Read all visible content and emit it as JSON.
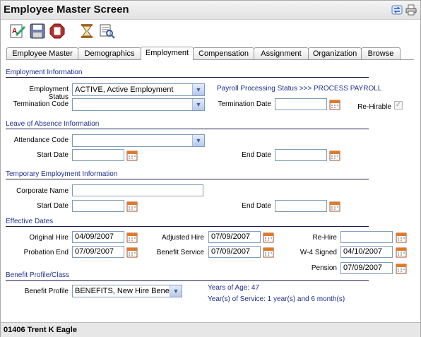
{
  "window": {
    "title": "Employee Master Screen"
  },
  "toolbar": {
    "icons": [
      "spell-check-icon",
      "save-icon",
      "stop-icon",
      "hourglass-icon",
      "lookup-icon"
    ]
  },
  "tabs": [
    {
      "label": "Employee Master"
    },
    {
      "label": "Demographics"
    },
    {
      "label": "Employment"
    },
    {
      "label": "Compensation"
    },
    {
      "label": "Assignment"
    },
    {
      "label": "Organization"
    },
    {
      "label": "Browse"
    }
  ],
  "active_tab": "Employment",
  "employment_info": {
    "heading": "Employment Information",
    "status_label": "Employment Status",
    "status_value": "ACTIVE, Active Employment",
    "payroll_status": "Payroll Processing Status >>> PROCESS PAYROLL",
    "termination_code_label": "Termination Code",
    "termination_code_value": "",
    "termination_date_label": "Termination Date",
    "termination_date_value": "",
    "rehirable_label": "Re-Hirable",
    "rehirable_checked": true
  },
  "leave_of_absence": {
    "heading": "Leave of Absence Information",
    "attendance_code_label": "Attendance Code",
    "attendance_code_value": "",
    "start_date_label": "Start Date",
    "start_date_value": "",
    "end_date_label": "End Date",
    "end_date_value": ""
  },
  "temporary_employment": {
    "heading": "Temporary Employment Information",
    "corporate_name_label": "Corporate Name",
    "corporate_name_value": "",
    "start_date_label": "Start Date",
    "start_date_value": "",
    "end_date_label": "End Date",
    "end_date_value": ""
  },
  "effective_dates": {
    "heading": "Effective Dates",
    "original_hire_label": "Original Hire",
    "original_hire_value": "04/09/2007",
    "adjusted_hire_label": "Adjusted Hire",
    "adjusted_hire_value": "07/09/2007",
    "rehire_label": "Re-Hire",
    "rehire_value": "",
    "probation_end_label": "Probation End",
    "probation_end_value": "07/09/2007",
    "benefit_service_label": "Benefit Service",
    "benefit_service_value": "07/09/2007",
    "w4_signed_label": "W-4 Signed",
    "w4_signed_value": "04/10/2007",
    "pension_label": "Pension",
    "pension_value": "07/09/2007"
  },
  "benefit_profile": {
    "heading": "Benefit Profile/Class",
    "profile_label": "Benefit Profile",
    "profile_value": "BENEFITS, New Hire Bene",
    "years_of_age": "Years of Age: 47",
    "years_of_service": "Year(s) of Service: 1 year(s) and 6 month(s)"
  },
  "status_bar": {
    "employee": "01406 Trent K Eagle"
  },
  "colors": {
    "section_heading": "#1f2f8f",
    "input_border": "#7f9db9"
  }
}
